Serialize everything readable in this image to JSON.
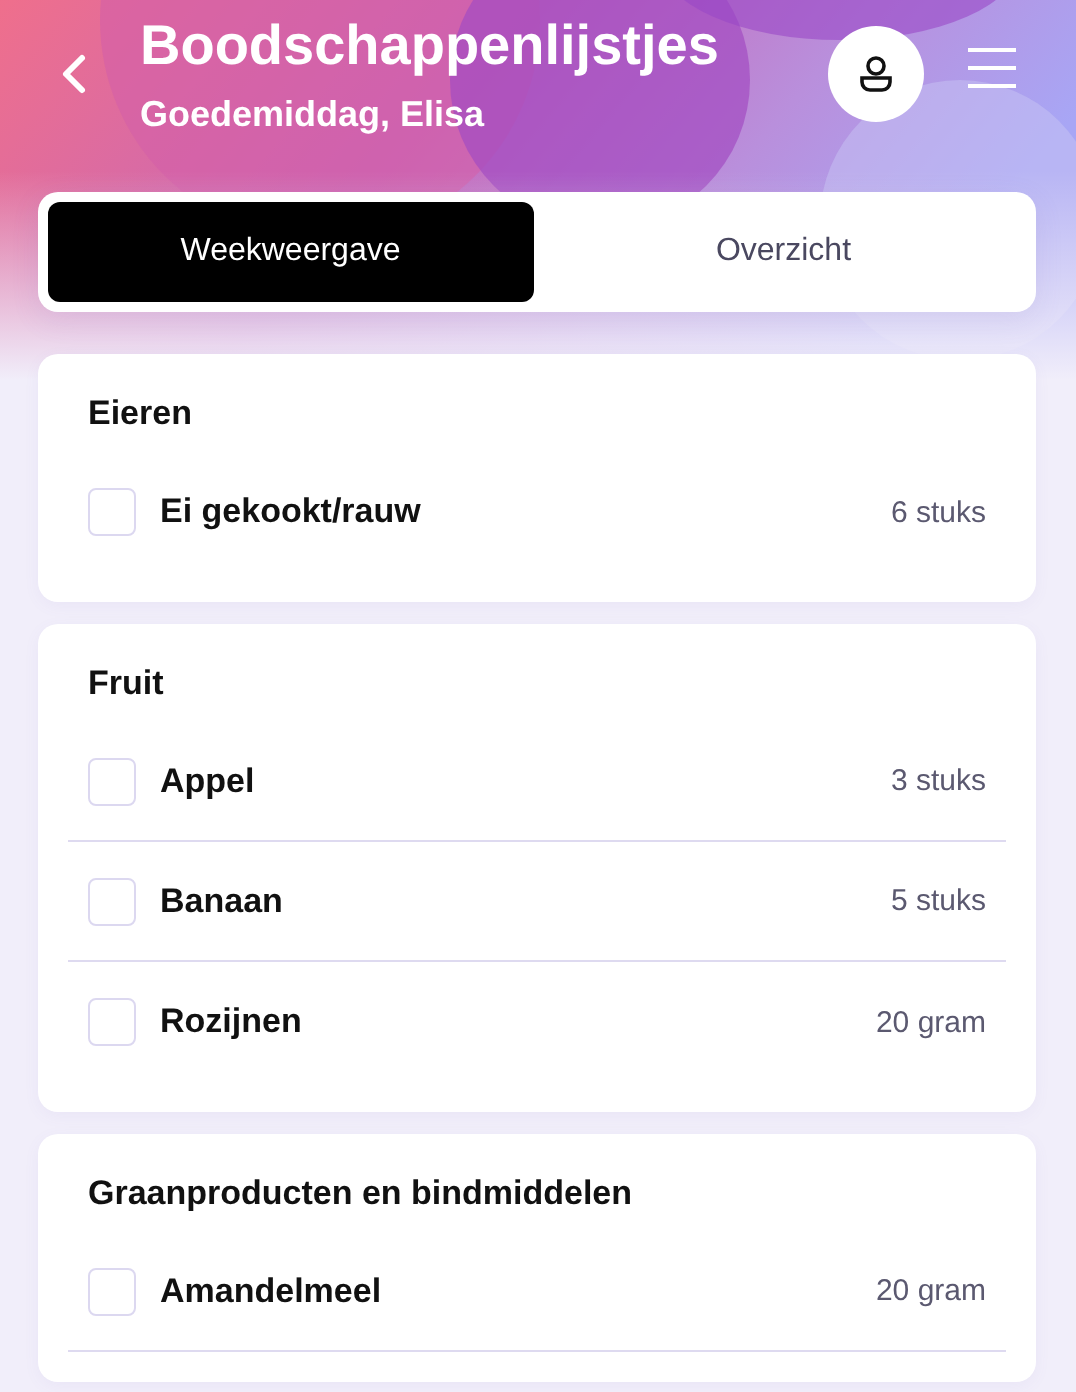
{
  "header": {
    "title": "Boodschappenlijstjes",
    "subtitle": "Goedemiddag, Elisa"
  },
  "tabs": [
    {
      "label": "Weekweergave",
      "selected": true
    },
    {
      "label": "Overzicht",
      "selected": false
    }
  ],
  "categories": [
    {
      "title": "Eieren",
      "items": [
        {
          "name": "Ei gekookt/rauw",
          "quantity": "6 stuks",
          "checked": false
        }
      ]
    },
    {
      "title": "Fruit",
      "items": [
        {
          "name": "Appel",
          "quantity": "3 stuks",
          "checked": false
        },
        {
          "name": "Banaan",
          "quantity": "5 stuks",
          "checked": false
        },
        {
          "name": "Rozijnen",
          "quantity": "20 gram",
          "checked": false
        }
      ]
    },
    {
      "title": "Graanproducten en bindmiddelen",
      "items": [
        {
          "name": "Amandelmeel",
          "quantity": "20 gram",
          "checked": false
        }
      ]
    }
  ]
}
